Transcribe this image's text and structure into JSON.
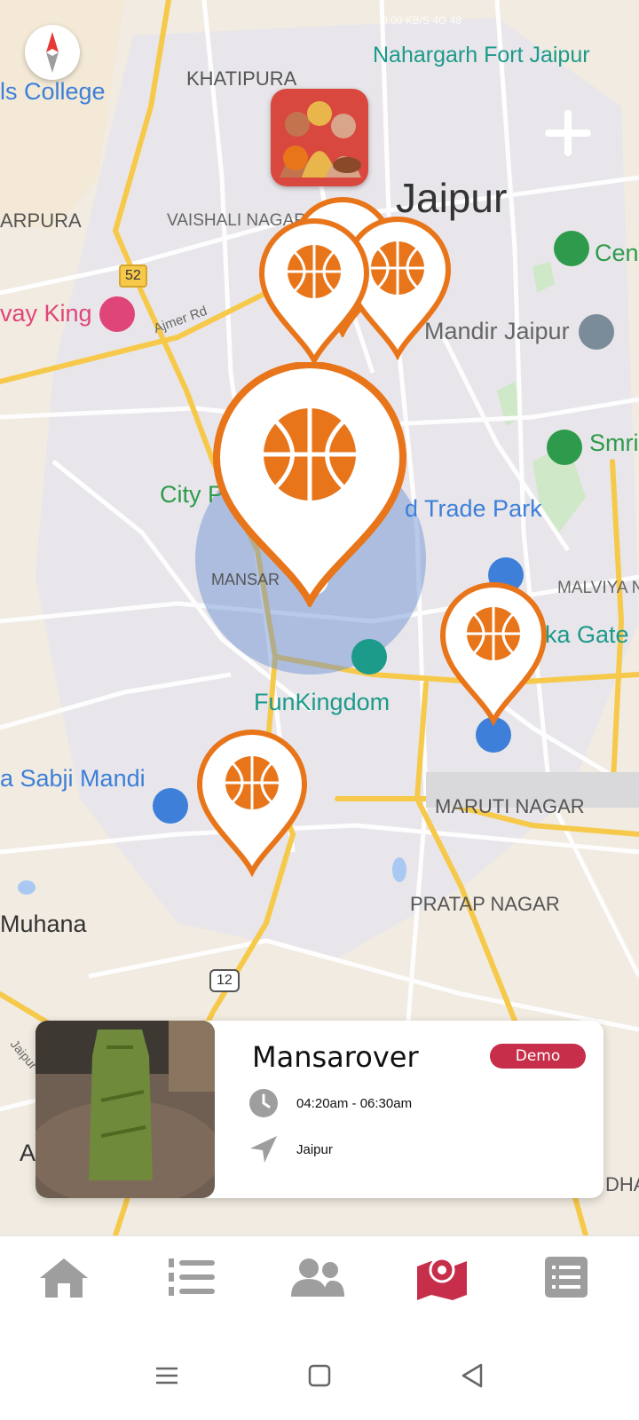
{
  "status_bar": {
    "text": "0.00 KB/S  4G  48"
  },
  "map": {
    "labels": {
      "college": "ls College",
      "khatipura": "KHATIPURA",
      "nahargarh": "Nahargarh Fort Jaipur",
      "jaipur": "Jaipur",
      "arpura": "ARPURA",
      "vaishali": "VAISHALI NAGAR",
      "highway52": "52",
      "way_king": "vay King",
      "ajmer_rd": "Ajmer Rd",
      "mandir": "Mandir Jaipur",
      "cen": "Cen",
      "smri": "Smri",
      "city_p": "City P",
      "trade_park": "d Trade Park",
      "mansarovar": "MANSAR",
      "malviya": "MALVIYA N",
      "ka_gate": "ka Gate",
      "funkingdom": "FunKingdom",
      "sabji_mandi": "a Sabji Mandi",
      "maruti_nagar": "MARUTI NAGAR",
      "pratap_nagar": "PRATAP NAGAR",
      "muhana": "Muhana",
      "highway12": "12",
      "jaipur_small": "Jaipur",
      "a_letter": "A",
      "dha": "DHA"
    },
    "colors": {
      "road": "#ffffff",
      "major_road": "#f6c94a",
      "land": "#f1ebe1",
      "pin_orange": "#e8751a"
    }
  },
  "card": {
    "title": "Mansarover",
    "badge": "Demo",
    "time": "04:20am - 06:30am",
    "location": "Jaipur",
    "clock_icon": "clock-icon",
    "location_icon": "navigation-arrow-icon"
  },
  "bottom_nav": [
    {
      "icon": "home-icon",
      "active": false
    },
    {
      "icon": "ranked-list-icon",
      "active": false
    },
    {
      "icon": "users-icon",
      "active": false
    },
    {
      "icon": "map-marker-icon",
      "active": true
    },
    {
      "icon": "list-icon",
      "active": false
    }
  ],
  "system_nav": [
    "menu-icon",
    "home-square-icon",
    "back-icon"
  ]
}
